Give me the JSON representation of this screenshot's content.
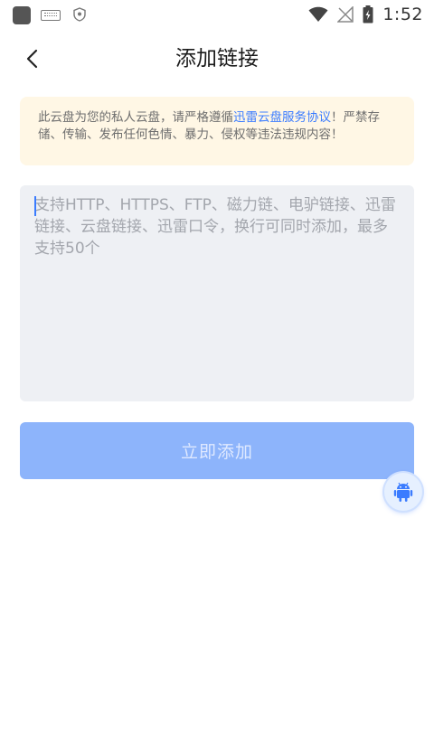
{
  "status_bar": {
    "time": "1:52",
    "icons": [
      "app-icon",
      "keyboard-icon",
      "shield-icon",
      "wifi-icon",
      "no-signal-icon",
      "battery-icon"
    ]
  },
  "header": {
    "title": "添加链接",
    "back_icon": "chevron-left-icon"
  },
  "notice": {
    "text_before": "此云盘为您的私人云盘，请严格遵循",
    "link_text": "迅雷云盘服务协议",
    "text_after": "！严禁存储、传输、发布任何色情、暴力、侵权等违法违规内容！"
  },
  "link_input": {
    "value": "",
    "placeholder": "支持HTTP、HTTPS、FTP、磁力链、电驴链接、迅雷链接、云盘链接、迅雷口令，换行可同时添加，最多支持50个"
  },
  "add_button": {
    "label": "立即添加"
  },
  "floating_button": {
    "icon": "android-robot-icon"
  },
  "colors": {
    "accent": "#3b7cff",
    "button_disabled": "#8db4fb",
    "notice_bg": "#fff7e5",
    "input_bg": "#eef0f4"
  }
}
